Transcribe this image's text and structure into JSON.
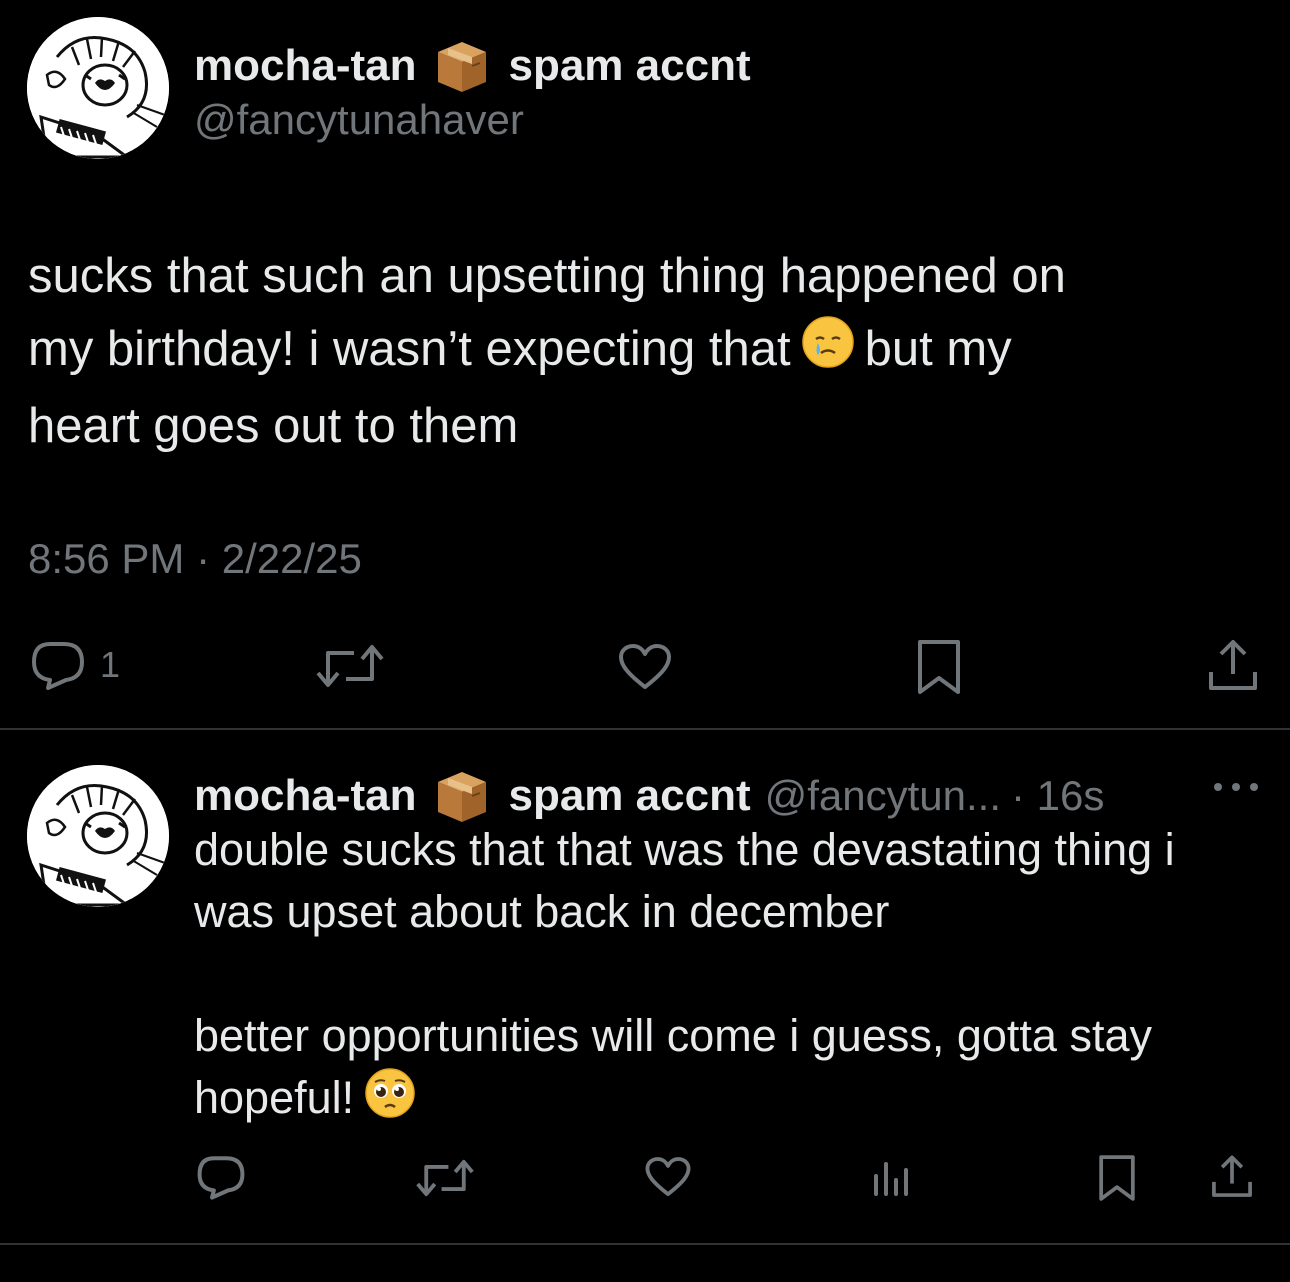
{
  "colors": {
    "background": "#000000",
    "text_primary": "#e7e9ea",
    "text_secondary": "#71767b",
    "divider": "#2f3336"
  },
  "main_tweet": {
    "display_name": "mocha-tan",
    "name_suffix": "spam accnt",
    "name_emoji": "package-box-emoji",
    "handle": "@fancytunahaver",
    "text_part1": "sucks that such an upsetting thing happened on\nmy birthday! i wasn’t expecting that",
    "text_emoji": "face-holding-back-tears-emoji",
    "text_part2": "but my\nheart goes out to them",
    "timestamp": "8:56 PM · 2/22/25",
    "actions": {
      "reply_icon": "reply-icon",
      "reply_count": "1",
      "retweet_icon": "retweet-icon",
      "like_icon": "heart-icon",
      "bookmark_icon": "bookmark-icon",
      "share_icon": "share-icon"
    }
  },
  "reply_tweet": {
    "display_name": "mocha-tan",
    "name_suffix": "spam accnt",
    "name_emoji": "package-box-emoji",
    "handle_truncated": "@fancytun...",
    "time_ago": "· 16s",
    "more_icon": "more-dots-icon",
    "text": "double sucks that that was the devastating thing i\nwas upset about back in december\n\nbetter opportunities will come i guess, gotta stay\nhopeful!",
    "text_emoji": "pleading-face-emoji",
    "actions": {
      "reply_icon": "reply-icon",
      "retweet_icon": "retweet-icon",
      "like_icon": "heart-icon",
      "views_icon": "views-chart-icon",
      "bookmark_icon": "bookmark-icon",
      "share_icon": "share-icon"
    }
  }
}
